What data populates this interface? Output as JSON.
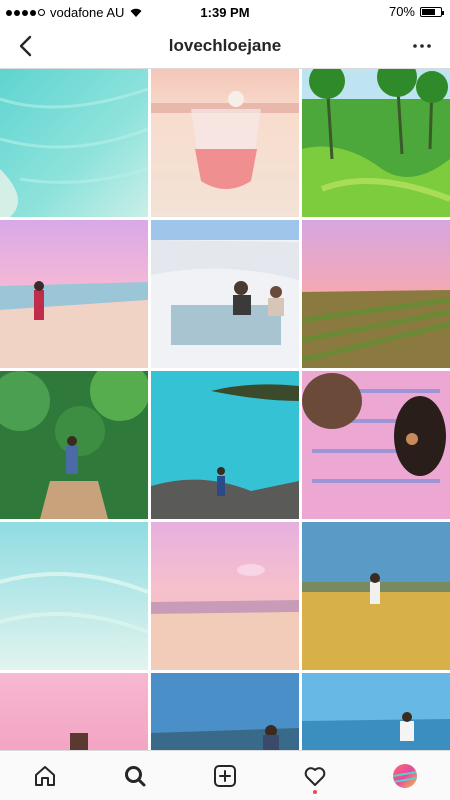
{
  "status": {
    "carrier": "vodafone AU",
    "time": "1:39 PM",
    "battery": "70%",
    "battery_level": 0.7
  },
  "header": {
    "title": "lovechloejane"
  },
  "tabs": [
    {
      "name": "home-icon"
    },
    {
      "name": "search-icon"
    },
    {
      "name": "add-icon"
    },
    {
      "name": "heart-icon"
    },
    {
      "name": "profile-avatar"
    }
  ]
}
